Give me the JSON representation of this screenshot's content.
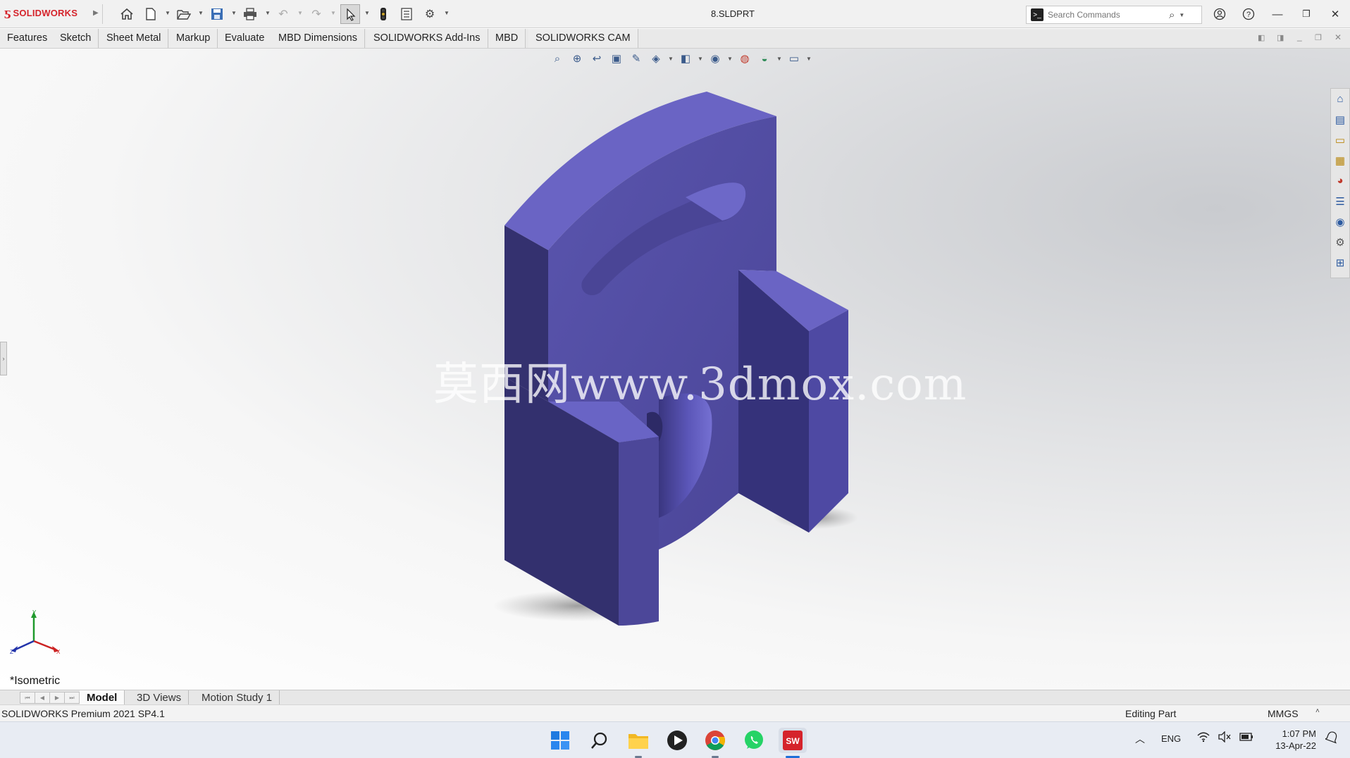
{
  "app": {
    "brand": "SOLIDWORKS",
    "document_title": "8.SLDPRT",
    "search_placeholder": "Search Commands"
  },
  "toolbar_icons": [
    "home-icon",
    "new-document-icon",
    "open-icon",
    "save-icon",
    "print-icon",
    "undo-icon",
    "redo-icon",
    "select-cursor-icon",
    "traffic-light-icon",
    "file-properties-icon",
    "options-gear-icon"
  ],
  "command_tabs": [
    "Features",
    "Sketch",
    "Sheet Metal",
    "Markup",
    "Evaluate",
    "MBD Dimensions",
    "SOLIDWORKS Add-Ins",
    "MBD",
    "SOLIDWORKS CAM"
  ],
  "viewport": {
    "view_name": "*Isometric",
    "watermark": "莫西网www.3dmox.com",
    "triad": {
      "x": "X",
      "y": "Y",
      "z": "Z"
    },
    "model_color": "#5b55b3"
  },
  "bottom_tabs": [
    "Model",
    "3D Views",
    "Motion Study 1"
  ],
  "status": {
    "version": "SOLIDWORKS Premium 2021 SP4.1",
    "mode": "Editing Part",
    "units": "MMGS"
  },
  "taskbar": {
    "language": "ENG",
    "time": "1:07 PM",
    "date": "13-Apr-22"
  },
  "colors": {
    "brand_red": "#d5232b",
    "face_top": "#6a64c4",
    "face_front": "#4e49a3",
    "face_side": "#33306e"
  }
}
